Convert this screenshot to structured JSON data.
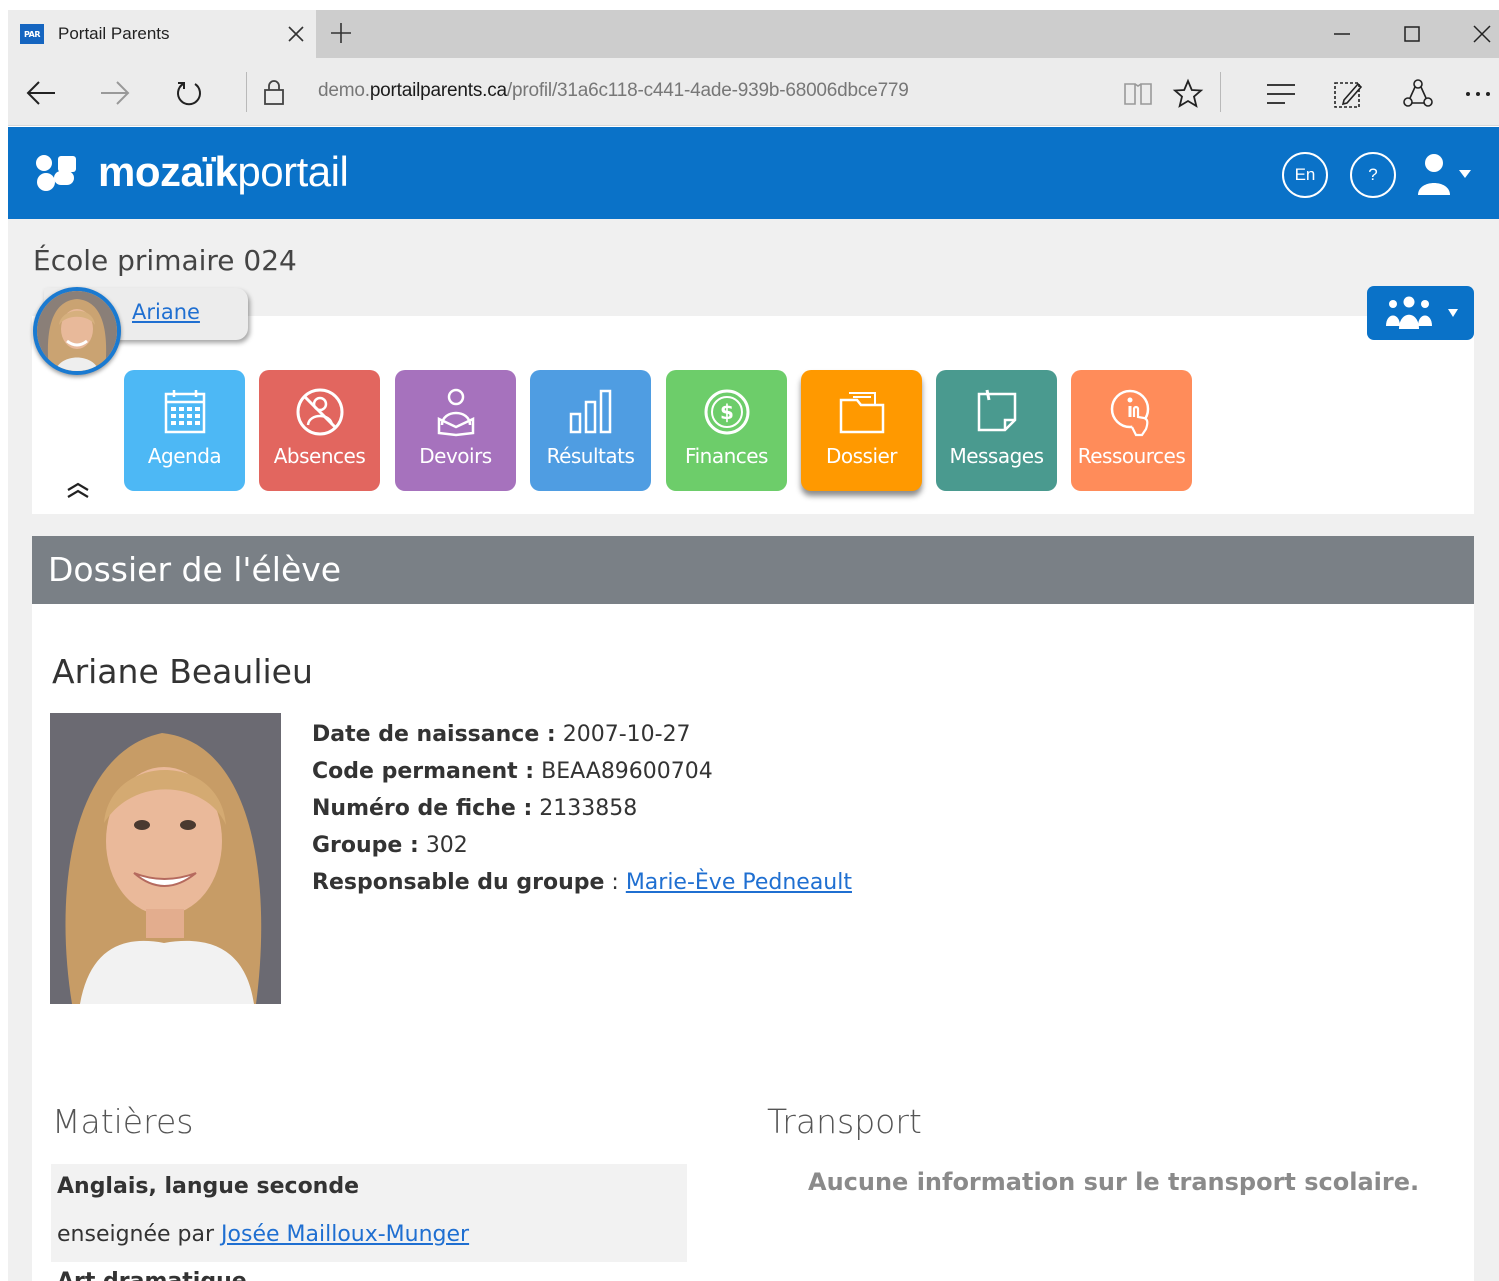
{
  "browser": {
    "favicon": "PAR",
    "tab_title": "Portail Parents",
    "url_prefix": "demo.",
    "url_host": "portailparents.ca",
    "url_path": "/profil/31a6c118-c441-4ade-939b-68006dbce779"
  },
  "header": {
    "logo_bold": "mozaïk",
    "logo_light": "portail",
    "lang_button": "En",
    "help_button": "?"
  },
  "school_name": "École primaire 024",
  "student_chip": "Ariane",
  "tiles": [
    {
      "label": "Agenda",
      "color": "#4db8f5",
      "icon": "calendar-icon"
    },
    {
      "label": "Absences",
      "color": "#e2665f",
      "icon": "absence-icon"
    },
    {
      "label": "Devoirs",
      "color": "#a672bd",
      "icon": "homework-icon"
    },
    {
      "label": "Résultats",
      "color": "#4f9de2",
      "icon": "bar-chart-icon"
    },
    {
      "label": "Finances",
      "color": "#6dcd6a",
      "icon": "dollar-icon"
    },
    {
      "label": "Dossier",
      "color": "#ff9900",
      "icon": "folder-icon"
    },
    {
      "label": "Messages",
      "color": "#4a9a8f",
      "icon": "note-icon"
    },
    {
      "label": "Ressources",
      "color": "#ff8c5a",
      "icon": "info-hand-icon"
    }
  ],
  "active_tile": "Dossier",
  "section_title": "Dossier de l'élève",
  "student": {
    "name": "Ariane Beaulieu",
    "birth_label": "Date de naissance :",
    "birth_value": "2007-10-27",
    "code_label": "Code permanent :",
    "code_value": "BEAA89600704",
    "file_label": "Numéro de fiche :",
    "file_value": "2133858",
    "group_label": "Groupe :",
    "group_value": "302",
    "responsible_label": "Responsable du groupe",
    "responsible_sep": " : ",
    "responsible_value": "Marie-Ève Pedneault"
  },
  "subjects": {
    "title": "Matières",
    "items": [
      {
        "name": "Anglais, langue seconde",
        "taught_by": "enseignée par ",
        "teacher": "Josée Mailloux-Munger"
      }
    ],
    "next_partial": "Art dramatique"
  },
  "transport": {
    "title": "Transport",
    "message": "Aucune information sur le transport scolaire."
  },
  "colors": {
    "brand_blue": "#0a72c8",
    "section_gray": "#7a8086",
    "link_blue": "#1f6fd1"
  }
}
